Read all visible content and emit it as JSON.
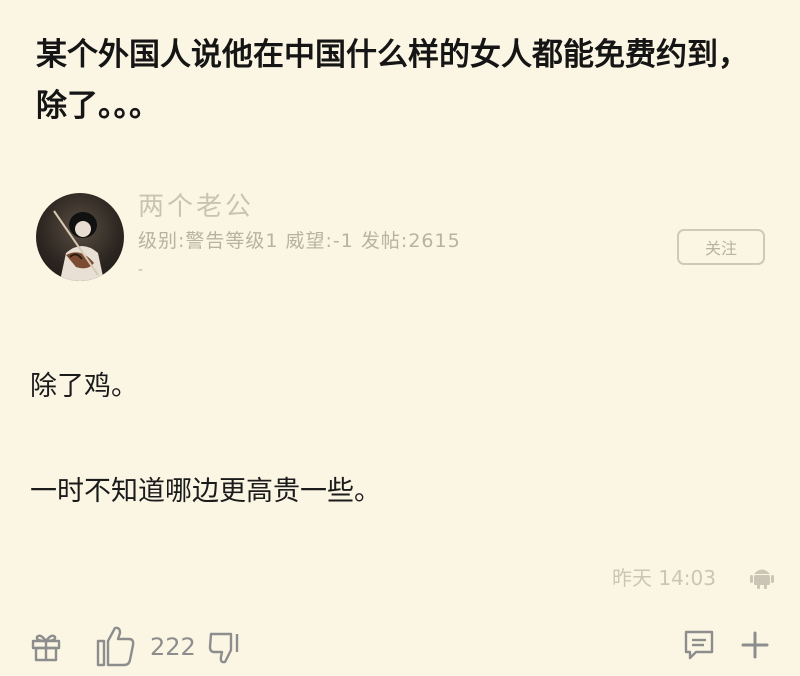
{
  "post": {
    "title": "某个外国人说他在中国什么样的女人都能免费约到，除了。。。"
  },
  "author": {
    "name": "两个老公",
    "meta": "级别:警告等级1 威望:-1 发帖:2615",
    "dash": "-",
    "follow_label": "关注"
  },
  "reply": {
    "paragraphs": [
      "除了鸡。",
      "一时不知道哪边更高贵一些。"
    ],
    "time": "昨天 14:03"
  },
  "actions": {
    "like_count": "222"
  },
  "icons": {
    "gift": "gift-icon",
    "like": "thumbs-up-icon",
    "dislike": "thumbs-down-icon",
    "comment": "comment-icon",
    "plus": "plus-icon",
    "device": "android-icon"
  },
  "colors": {
    "background": "#fbf6e4",
    "title_text": "#151515",
    "muted_text": "#b8b2a2",
    "icon_gray": "#8d8d8d"
  }
}
